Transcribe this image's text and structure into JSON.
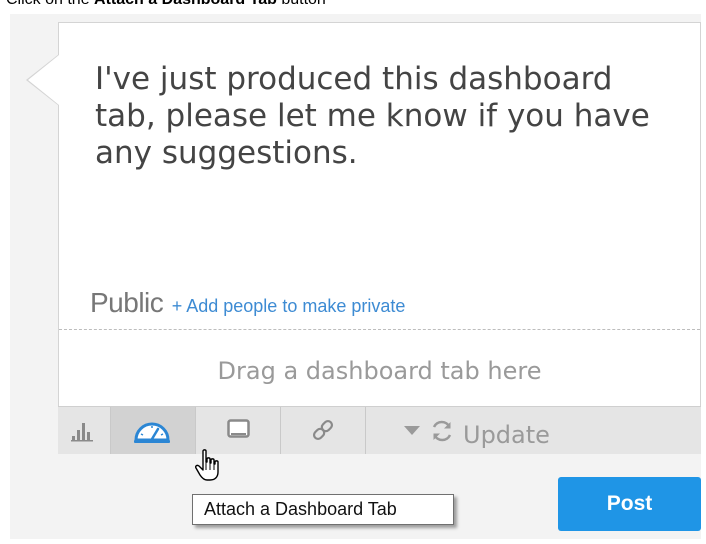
{
  "instruction": {
    "prefix": "Click on the ",
    "target": "Attach a Dashboard Tab",
    "suffix": " button"
  },
  "composer": {
    "message": "I've just produced this dashboard tab, please let me know if you have any suggestions.",
    "visibility_label": "Public",
    "add_people_link": "+ Add people to make private",
    "drop_hint": "Drag a dashboard tab here"
  },
  "toolbar": {
    "buttons": [
      {
        "icon": "bar-chart-icon",
        "active": false
      },
      {
        "icon": "dashboard-gauge-icon",
        "active": true
      },
      {
        "icon": "monitor-icon",
        "active": false
      },
      {
        "icon": "link-icon",
        "active": false
      }
    ],
    "update_label": "Update",
    "dropdown_icon": "caret-down-icon",
    "refresh_icon": "refresh-icon"
  },
  "tooltip": "Attach a Dashboard Tab",
  "post_label": "Post",
  "colors": {
    "accent": "#1f95e6",
    "link": "#3d8bd3",
    "gauge_icon": "#2b86d4"
  }
}
